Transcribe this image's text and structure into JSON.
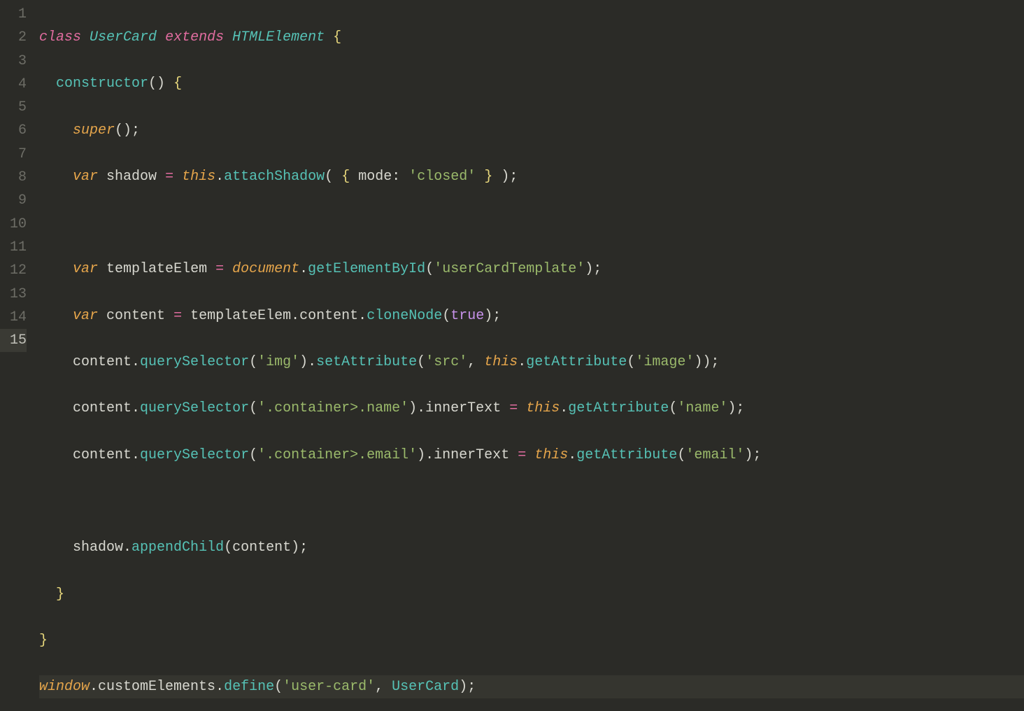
{
  "gutter": [
    "1",
    "2",
    "3",
    "4",
    "5",
    "6",
    "7",
    "8",
    "9",
    "10",
    "11",
    "12",
    "13",
    "14",
    "15"
  ],
  "activeLine": 15,
  "tokens": {
    "class": "class",
    "UserCard": "UserCard",
    "extends": "extends",
    "HTMLElement": "HTMLElement",
    "constructor": "constructor",
    "super": "super",
    "var": "var",
    "shadow": "shadow",
    "this": "this",
    "attachShadow": "attachShadow",
    "mode": "mode",
    "closed": "'closed'",
    "templateElem": "templateElem",
    "document": "document",
    "getElementById": "getElementById",
    "userCardTemplate": "'userCardTemplate'",
    "content": "content",
    "cloneNode": "cloneNode",
    "true": "true",
    "querySelector": "querySelector",
    "img": "'img'",
    "setAttribute": "setAttribute",
    "src": "'src'",
    "getAttribute": "getAttribute",
    "image": "'image'",
    "containerName": "'.container>.name'",
    "innerText": "innerText",
    "name": "'name'",
    "containerEmail": "'.container>.email'",
    "email": "'email'",
    "appendChild": "appendChild",
    "window": "window",
    "customElements": "customElements",
    "define": "define",
    "userCard": "'user-card'"
  }
}
